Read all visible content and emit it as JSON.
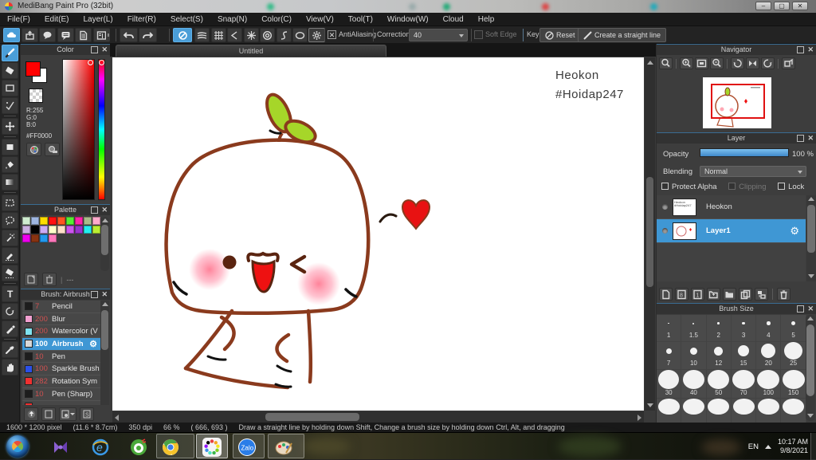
{
  "window": {
    "title": "MediBang Paint Pro (32bit)"
  },
  "menu": {
    "items": [
      "File(F)",
      "Edit(E)",
      "Layer(L)",
      "Filter(R)",
      "Select(S)",
      "Snap(N)",
      "Color(C)",
      "View(V)",
      "Tool(T)",
      "Window(W)",
      "Cloud",
      "Help"
    ]
  },
  "toolbar": {
    "antialiasing_label": "AntiAliasing",
    "correction_label": "Correction",
    "correction_value": "40",
    "soft_edge_label": "Soft Edge",
    "key_label": "Key",
    "reset_label": "Reset",
    "straight_line_label": "Create a straight line",
    "left_icons": [
      "cloud",
      "upload",
      "comment",
      "comment-box",
      "document",
      "document-list"
    ],
    "snap_icons": [
      "snap-off",
      "snap-parallel",
      "snap-grid",
      "snap-vanish",
      "snap-radial",
      "snap-concentric",
      "snap-curve",
      "snap-ellipse",
      "snap-settings"
    ]
  },
  "toolstrip": {
    "tools": [
      "brush",
      "eraser",
      "rectangle",
      "dot-pen",
      "move",
      "select-rect",
      "bucket",
      "gradient",
      "select-marquee",
      "select-lasso",
      "magic-wand",
      "select-pen",
      "select-eraser",
      "text",
      "rotate-select",
      "pen-white",
      "eyedropper",
      "hand"
    ],
    "selected": "brush"
  },
  "color_panel": {
    "title": "Color",
    "r": "R:255",
    "g": "G:0",
    "b": "B:0",
    "hex": "#FF0000",
    "foreground": "#ff0000",
    "background": "#ffffff"
  },
  "palette_panel": {
    "title": "Palette",
    "footer_text": "---",
    "colors": [
      "#cfeccf",
      "#9fb6e0",
      "#ffdd00",
      "#ff1111",
      "#ff5522",
      "#55ee33",
      "#ff22aa",
      "#a8bb8a",
      "#ffaacc",
      "#c9aede",
      "#000000",
      "#cbaaf5",
      "#ffffc9",
      "#ffdfc9",
      "#cc55ee",
      "#9933cc",
      "#22eeee",
      "#bbee33",
      "#ee00ee",
      "#883311",
      "#2299ee",
      "#ff77bb"
    ]
  },
  "brush_panel": {
    "title": "Brush: Airbrush",
    "brushes": [
      {
        "size": "7",
        "name": "Pencil",
        "swatch": "#1d1d1d",
        "selected": false
      },
      {
        "size": "200",
        "name": "Blur",
        "swatch": "#f2a0d0",
        "selected": false
      },
      {
        "size": "200",
        "name": "Watercolor (V",
        "swatch": "#7fe3f0",
        "selected": false
      },
      {
        "size": "100",
        "name": "Airbrush",
        "swatch": "#d8d8d8",
        "selected": true
      },
      {
        "size": "10",
        "name": "Pen",
        "swatch": "#1d1d1d",
        "selected": false
      },
      {
        "size": "100",
        "name": "Sparkle Brush",
        "swatch": "#2b50e8",
        "selected": false
      },
      {
        "size": "282",
        "name": "Rotation Sym",
        "swatch": "#f03030",
        "selected": false
      },
      {
        "size": "10",
        "name": "Pen (Sharp)",
        "swatch": "#1d1d1d",
        "selected": false
      },
      {
        "size": "",
        "name": "",
        "swatch": "#f03030",
        "selected": false
      }
    ]
  },
  "canvas": {
    "tab": "Untitled",
    "text_line1": "Heokon",
    "text_line2": "#Hoidap247"
  },
  "navigator": {
    "title": "Navigator",
    "icons": [
      "zoom-tool",
      "zoom-in",
      "fit-screen",
      "zoom-out",
      "rotate-ccw",
      "flip-view",
      "rotate-cw",
      "reset-view"
    ]
  },
  "layer_panel": {
    "title": "Layer",
    "opacity_label": "Opacity",
    "opacity_value": "100 %",
    "blending_label": "Blending",
    "blending_value": "Normal",
    "protect_alpha_label": "Protect Alpha",
    "clipping_label": "Clipping",
    "lock_label": "Lock",
    "layers": [
      {
        "name": "Heokon",
        "selected": false,
        "thumb": "text"
      },
      {
        "name": "Layer1",
        "selected": true,
        "thumb": "drawing"
      }
    ],
    "footer_icons": [
      "new-layer",
      "new-8bit-layer",
      "new-1bit-layer",
      "add-layer-menu",
      "new-folder",
      "duplicate-layer",
      "merge-layer",
      "delete-layer"
    ]
  },
  "brush_size_panel": {
    "title": "Brush Size",
    "rows": [
      {
        "labels": [
          "1",
          "1.5",
          "2",
          "3",
          "4",
          "5"
        ],
        "diams": [
          1.5,
          2,
          2.5,
          3.5,
          4.5,
          5.5
        ]
      },
      {
        "labels": [
          "7",
          "10",
          "12",
          "15",
          "20",
          "25"
        ],
        "diams": [
          7,
          9,
          11,
          14,
          18,
          23
        ]
      },
      {
        "labels": [
          "30",
          "40",
          "50",
          "70",
          "100",
          "150"
        ],
        "diams": [
          26,
          27,
          27,
          28,
          28,
          28
        ]
      },
      {
        "labels": [
          "",
          "",
          "",
          "",
          "",
          ""
        ],
        "diams": [
          27,
          27,
          27,
          27,
          27,
          27
        ]
      }
    ]
  },
  "status_bar": {
    "segments": [
      "1600 * 1200 pixel",
      "(11.6 * 8.7cm)",
      "350 dpi",
      "66 %",
      "( 666, 693 )",
      "Draw a straight line by holding down Shift, Change a brush size by holding down Ctrl, Alt, and dragging"
    ]
  },
  "taskbar": {
    "language": "EN",
    "time": "10:17 AM",
    "date": "9/8/2021",
    "apps": [
      {
        "name": "kmplayer",
        "open": false
      },
      {
        "name": "internet-explorer",
        "open": false
      },
      {
        "name": "coccoc",
        "open": false
      },
      {
        "name": "chrome",
        "open": true
      },
      {
        "name": "medibang",
        "open": true,
        "active": true
      },
      {
        "name": "zalo",
        "open": true
      },
      {
        "name": "paint",
        "open": true
      }
    ]
  }
}
